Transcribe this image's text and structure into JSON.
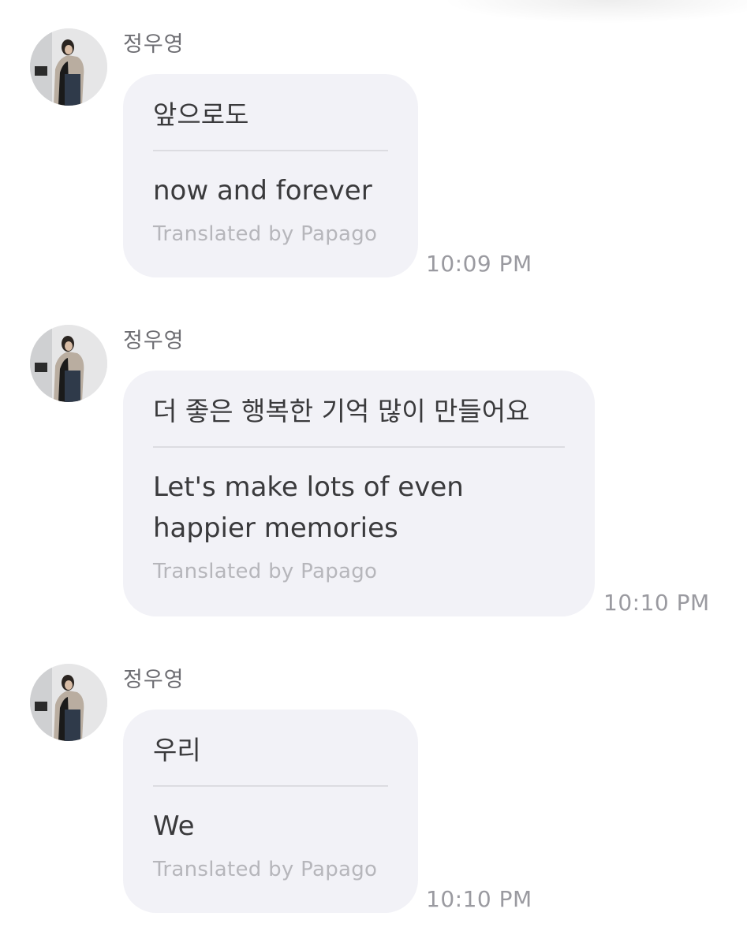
{
  "messages": [
    {
      "sender": "정우영",
      "original": "앞으로도",
      "translated": "now and forever",
      "credit": "Translated by Papago",
      "time": "10:09 PM"
    },
    {
      "sender": "정우영",
      "original": "더 좋은 행복한 기억 많이 만들어요",
      "translated": "Let's make lots of even happier memories",
      "credit": "Translated by Papago",
      "time": "10:10 PM"
    },
    {
      "sender": "정우영",
      "original": "우리",
      "translated": "We",
      "credit": "Translated by Papago",
      "time": "10:10 PM"
    }
  ],
  "colors": {
    "bubble": "#f2f2f7",
    "text": "#3a3a3c",
    "sender": "#6d6d72",
    "credit": "#b6b6bb",
    "time": "#9a9aa0",
    "divider": "#dcdce1"
  }
}
